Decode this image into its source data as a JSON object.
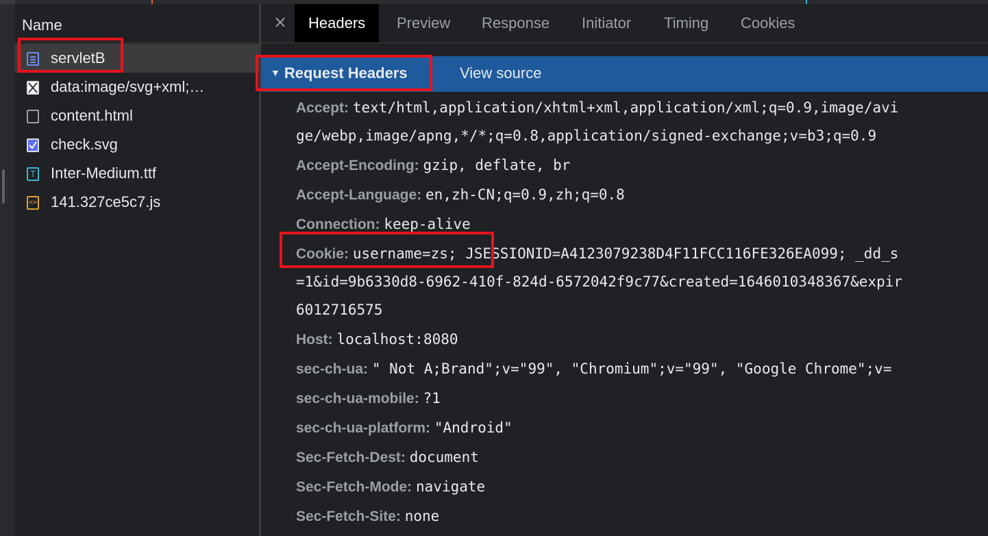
{
  "name_panel": {
    "header": "Name",
    "files": [
      {
        "name": "servletB",
        "icon": "document-icon"
      },
      {
        "name": "data:image/svg+xml;…",
        "icon": "image-icon"
      },
      {
        "name": "content.html",
        "icon": "blank-file-icon"
      },
      {
        "name": "check.svg",
        "icon": "checkbox-icon"
      },
      {
        "name": "Inter-Medium.ttf",
        "icon": "font-file-icon"
      },
      {
        "name": "141.327ce5c7.js",
        "icon": "script-file-icon"
      }
    ]
  },
  "tabs": {
    "close_symbol": "×",
    "items": [
      "Headers",
      "Preview",
      "Response",
      "Initiator",
      "Timing",
      "Cookies"
    ],
    "active": "Headers"
  },
  "request_headers": {
    "title": "Request Headers",
    "view_source": "View source",
    "rows": [
      {
        "key": "Accept:",
        "value": "text/html,application/xhtml+xml,application/xml;q=0.9,image/avi",
        "cont": [
          "ge/webp,image/apng,*/*;q=0.8,application/signed-exchange;v=b3;q=0.9"
        ]
      },
      {
        "key": "Accept-Encoding:",
        "value": "gzip, deflate, br"
      },
      {
        "key": "Accept-Language:",
        "value": "en,zh-CN;q=0.9,zh;q=0.8"
      },
      {
        "key": "Connection:",
        "value": "keep-alive"
      },
      {
        "key": "Cookie:",
        "value": "username=zs; JSESSIONID=A4123079238D4F11FCC116FE326EA099; _dd_s",
        "cont": [
          "=1&id=9b6330d8-6962-410f-824d-6572042f9c77&created=1646010348367&expir",
          "6012716575"
        ]
      },
      {
        "key": "Host:",
        "value": "localhost:8080"
      },
      {
        "key": "sec-ch-ua:",
        "value": "\" Not A;Brand\";v=\"99\", \"Chromium\";v=\"99\", \"Google Chrome\";v="
      },
      {
        "key": "sec-ch-ua-mobile:",
        "value": "?1"
      },
      {
        "key": "sec-ch-ua-platform:",
        "value": "\"Android\""
      },
      {
        "key": "Sec-Fetch-Dest:",
        "value": "document"
      },
      {
        "key": "Sec-Fetch-Mode:",
        "value": "navigate"
      },
      {
        "key": "Sec-Fetch-Site:",
        "value": "none"
      }
    ]
  },
  "colors": {
    "background": "#202124",
    "section_header": "#1e5a9c",
    "highlight_box": "#e8131d",
    "header_key": "#9aa0a6"
  }
}
